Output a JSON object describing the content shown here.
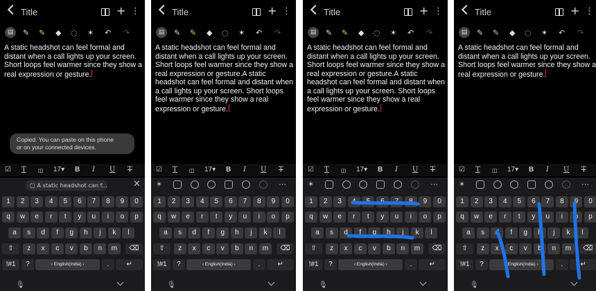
{
  "header": {
    "title": "Title"
  },
  "note_text_short": "A static headshot can feel formal and distant when a call lights up your screen. Short loops feel warmer since they show a real expression or gesture.",
  "note_text_long": "A static headshot can feel formal and distant when a call lights up your screen. Short loops feel warmer since they show a real expression or gesture.A static headshot can feel formal and distant when a call lights up your screen. Short loops feel warmer since they show a real expression or gesture.",
  "toast": {
    "line1": "Copied. You can paste on this phone",
    "line2": "or on your connected devices."
  },
  "format_bar": {
    "font_size": "17",
    "bold": "B",
    "italic": "I",
    "underline": "U",
    "strike": "T"
  },
  "clipboard": {
    "chip": "A static headshot can f..."
  },
  "keyboard": {
    "numbers": [
      "1",
      "2",
      "3",
      "4",
      "5",
      "6",
      "7",
      "8",
      "9",
      "0"
    ],
    "row1": [
      "q",
      "w",
      "e",
      "r",
      "t",
      "y",
      "u",
      "i",
      "o",
      "p"
    ],
    "row2": [
      "a",
      "s",
      "d",
      "f",
      "g",
      "h",
      "j",
      "k",
      "l"
    ],
    "row3": [
      "z",
      "x",
      "c",
      "v",
      "b",
      "n",
      "m"
    ],
    "symbols": "!#1",
    "question": "?",
    "space_label": "English(India)",
    "comma": ",",
    "period": "."
  },
  "icons": [
    "back-icon",
    "book-icon",
    "plus-icon",
    "more-icon",
    "text-mode-icon",
    "pen-icon",
    "highlighter-icon",
    "eraser-icon",
    "lasso-icon",
    "pin-icon",
    "undo-icon",
    "redo-icon",
    "mic-icon",
    "hide-keyboard-icon"
  ],
  "colors": {
    "background": "#000000",
    "keyboard": "#1b1b1d",
    "key": "#3a3a3d",
    "highlighter": "#e7d14a",
    "swipe_stroke": "#1e73e8",
    "cursor": "#e33333"
  }
}
